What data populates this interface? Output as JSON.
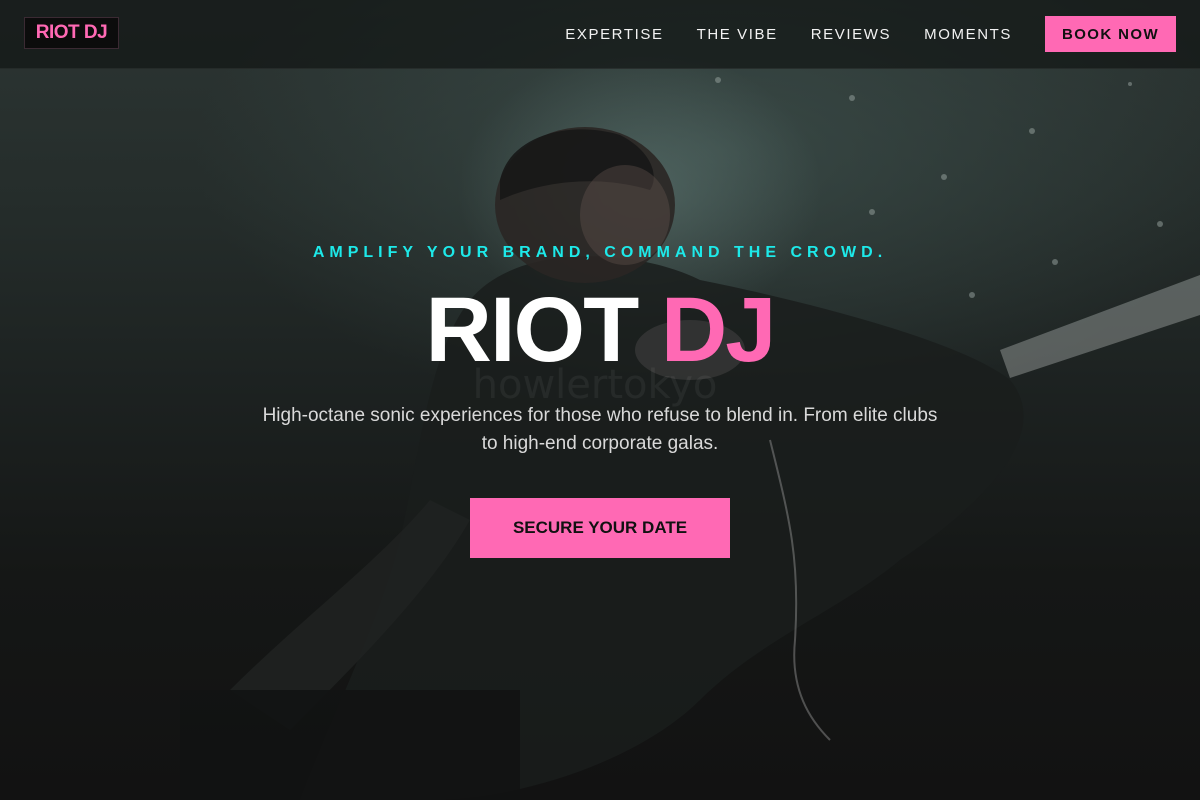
{
  "nav": {
    "logo": "RIOT DJ",
    "links": [
      "EXPERTISE",
      "THE VIBE",
      "REVIEWS",
      "MOMENTS"
    ],
    "book_label": "BOOK NOW"
  },
  "hero": {
    "tagline": "AMPLIFY YOUR BRAND, COMMAND THE CROWD.",
    "title_part1": "RIOT",
    "title_part2": "DJ",
    "description": "High-octane sonic experiences for those who refuse to blend in. From elite clubs to high-end corporate galas.",
    "cta_label": "SECURE YOUR DATE"
  },
  "colors": {
    "accent_pink": "#ff69b4",
    "accent_cyan": "#1de9e9",
    "background": "#141414"
  }
}
